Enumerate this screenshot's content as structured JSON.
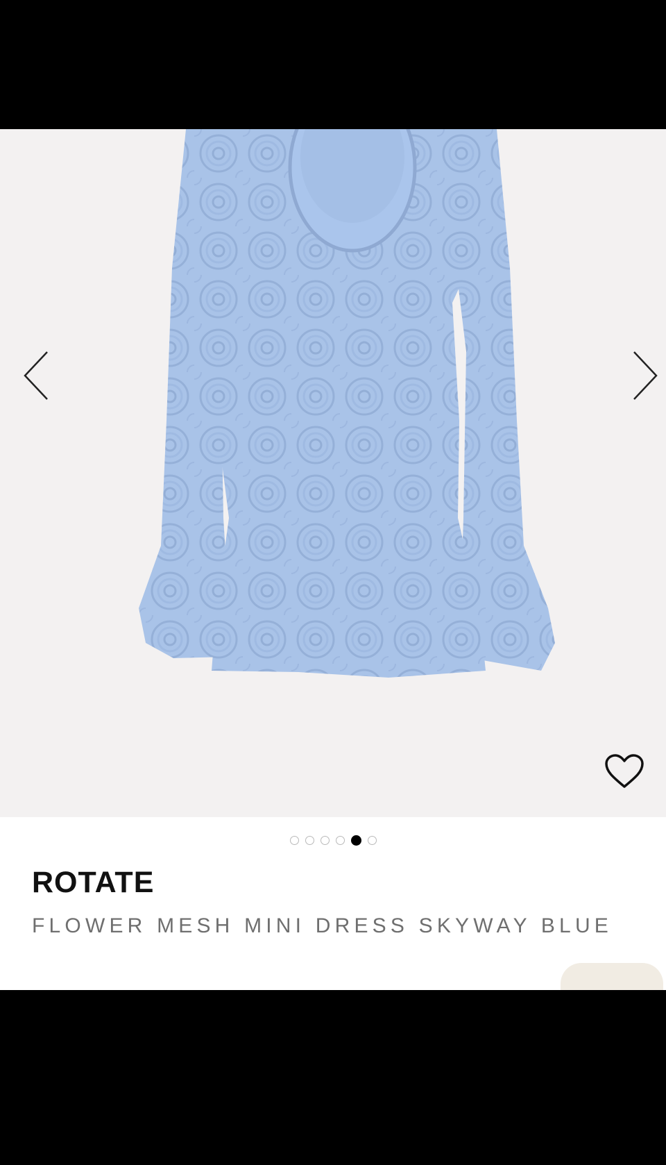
{
  "product": {
    "brand": "ROTATE",
    "name": "FLOWER MESH MINI DRESS SKYWAY BLUE",
    "image_description": "light blue flower mesh mini dress with flared sleeves"
  },
  "gallery": {
    "total_images": 6,
    "active_index": 5,
    "prev_icon": "chevron-left-icon",
    "next_icon": "chevron-right-icon",
    "wishlist_icon": "heart-outline-icon"
  },
  "colors": {
    "gallery_background": "#f3f1f1",
    "dress": "#a9c3e8",
    "brand_text": "#111111",
    "name_text": "#6f6f6f",
    "chat_tab": "#f1ece3"
  }
}
